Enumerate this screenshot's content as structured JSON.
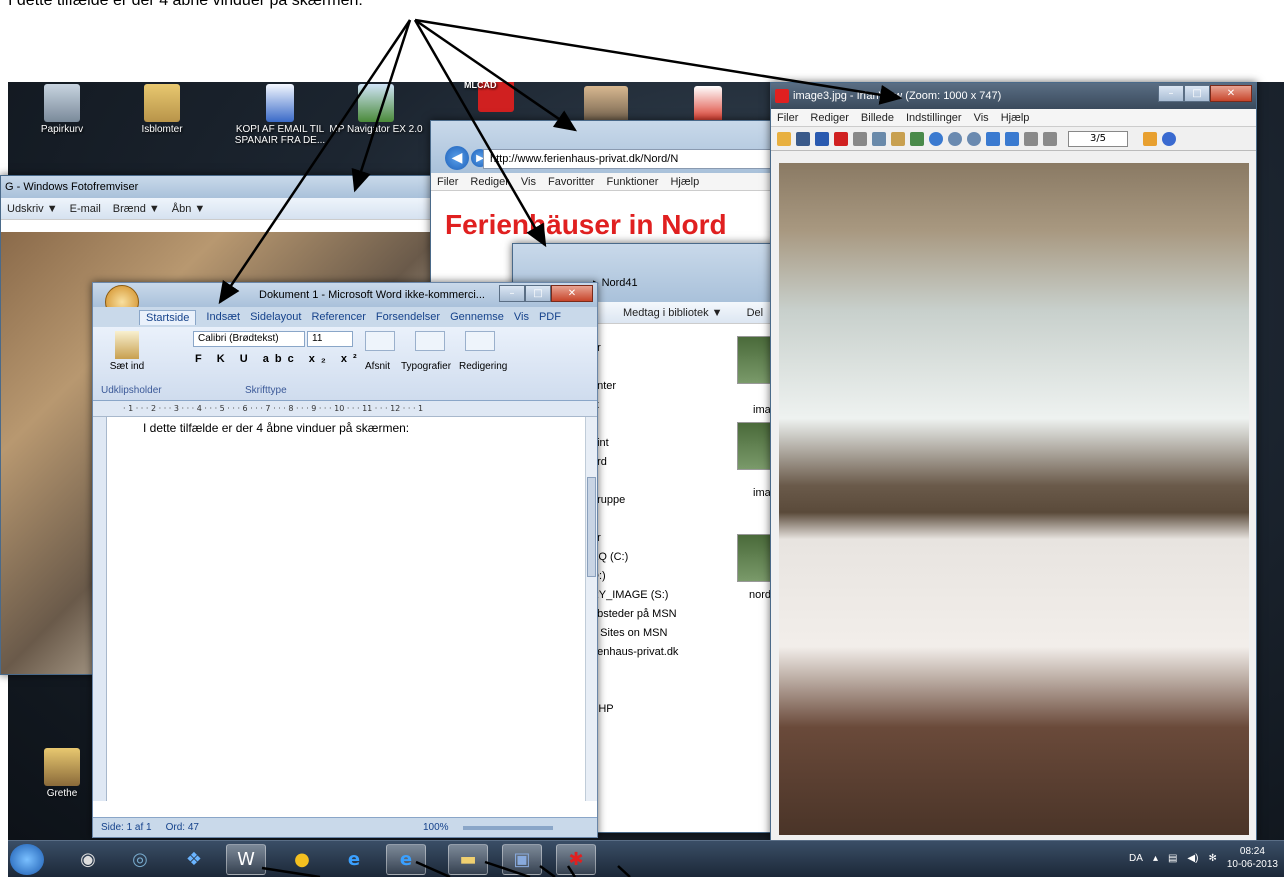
{
  "caption": "I dette tilfælde er der 4 åbne vinduer på skærmen:",
  "desktop_icons": [
    {
      "label": "Papirkurv"
    },
    {
      "label": "Isblomter"
    },
    {
      "label": "KOPI AF EMAIL  TIL SPANAIR FRA DE..."
    },
    {
      "label": "MP Navigator EX 2.0"
    },
    {
      "label": "MLCAD"
    },
    {
      "label": "Grethe"
    }
  ],
  "foto": {
    "title": "G - Windows Fotofremviser",
    "menu": [
      "Udskriv ▼",
      "E-mail",
      "Brænd ▼",
      "Åbn ▼"
    ]
  },
  "browser": {
    "url": "http://www.ferienhaus-privat.dk/Nord/N",
    "menu": [
      "Filer",
      "Rediger",
      "Vis",
      "Favoritter",
      "Funktioner",
      "Hjælp"
    ],
    "headline": "Ferienhäuser in Nord"
  },
  "explorer": {
    "breadcrumb": "▸ Nord41",
    "toolbar": [
      "Medtag i bibliotek ▼",
      "Del"
    ],
    "nav_items": [
      "er",
      "",
      "enter",
      "ix",
      "",
      "oint",
      "ord",
      "",
      "gruppe",
      "",
      "er",
      "AQ (C:)",
      "D:)",
      "RY_IMAGE (S:)",
      "ebsteder på MSN",
      "b Sites on MSN",
      "rienhaus-privat.dk",
      "",
      "",
      "SHP"
    ],
    "thumb_labels": [
      "ima",
      "ima",
      "nord"
    ]
  },
  "irfan": {
    "title": "image3.jpg - IrfanView (Zoom: 1000 x 747)",
    "menu": [
      "Filer",
      "Rediger",
      "Billede",
      "Indstillinger",
      "Vis",
      "Hjælp"
    ],
    "page": "3/5"
  },
  "word": {
    "title": "Dokument 1 - Microsoft Word ikke-kommerci...",
    "tabs": [
      "Startside",
      "Indsæt",
      "Sidelayout",
      "Referencer",
      "Forsendelser",
      "Gennemse",
      "Vis",
      "PDF"
    ],
    "font_name": "Calibri (Brødtekst)",
    "font_size": "11",
    "paste_label": "Sæt ind",
    "groups": [
      "Udklipsholder",
      "Skrifttype"
    ],
    "big_buttons": [
      "Afsnit",
      "Typografier",
      "Redigering"
    ],
    "ruler": "· 1 · · · 2 · · · 3 · · · 4 · · · 5 · · · 6 · · · 7 · · · 8 · · · 9 · · · 10 · · · 11 · · · 12 · · · 1",
    "body": "I dette tilfælde er der 4 åbne vinduer på skærmen:",
    "status": {
      "page": "Side: 1 af 1",
      "words": "Ord: 47",
      "zoom": "100%"
    }
  },
  "taskbar": {
    "lang": "DA",
    "time": "08:24",
    "date": "10-06-2013"
  }
}
